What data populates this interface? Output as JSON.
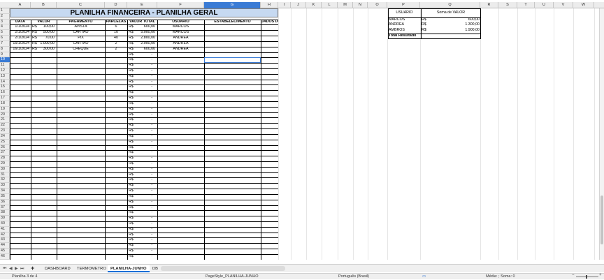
{
  "columns": [
    "A",
    "B",
    "C",
    "D",
    "E",
    "F",
    "G",
    "H",
    "I",
    "J",
    "K",
    "L",
    "M",
    "N",
    "O",
    "P",
    "Q",
    "R",
    "S",
    "T",
    "U",
    "V",
    "W"
  ],
  "selected_column": "G",
  "selected_row": 10,
  "sheet_title": "PLANILHA FINANCEIRA - PLANILHA GERAL",
  "table_headers": [
    "DATA",
    "VALOR",
    "PAGAMENTO",
    "PARCELAS",
    "VALOR TOTAL",
    "USUÁRIO",
    "ESTABELECIMENTO",
    "DADOS DO GASTO"
  ],
  "rows": [
    {
      "data": "1/1/2024",
      "cur": "R$",
      "valor": "100,00",
      "pagamento": "AVISTA",
      "parcelas": "6",
      "cur2": "R$",
      "total": "600,00",
      "usuario": "MARCOS"
    },
    {
      "data": "2/1/2024",
      "cur": "R$",
      "valor": "500,00",
      "pagamento": "CARTÃO",
      "parcelas": "10",
      "cur2": "R$",
      "total": "5.000,00",
      "usuario": "MARCOS"
    },
    {
      "data": "2/1/2024",
      "cur": "R$",
      "valor": "70,00",
      "pagamento": "PIX",
      "parcelas": "40",
      "cur2": "R$",
      "total": "2.800,00",
      "usuario": "ANDREA"
    },
    {
      "data": "15/1/2024",
      "cur": "R$",
      "valor": "1.000,00",
      "pagamento": "CARTÃO",
      "parcelas": "2",
      "cur2": "R$",
      "total": "2.000,00",
      "usuario": "ANDREA"
    },
    {
      "data": "16/1/2024",
      "cur": "R$",
      "valor": "300,00",
      "pagamento": "CHEQUE",
      "parcelas": "2",
      "cur2": "R$",
      "total": "600,00",
      "usuario": "ANDREA"
    }
  ],
  "empty_total_cur": "R$",
  "empty_total_val": "-",
  "pivot": {
    "header_label": "USUÁRIO",
    "header_value": "Soma de VALOR",
    "rows": [
      {
        "label": "MARCOS",
        "cur": "R$",
        "value": "600,00"
      },
      {
        "label": "ANDREA",
        "cur": "R$",
        "value": "1.300,00"
      },
      {
        "label": "AMBROS",
        "cur": "R$",
        "value": "1.900,00"
      }
    ],
    "total_label": "Total Resultado"
  },
  "tabs": [
    "DASHBOARD",
    "TERMOMETRO",
    "PLANILHA-JUNHO",
    "DB"
  ],
  "active_tab": "PLANILHA-JUNHO",
  "add_sheet": "+",
  "status": {
    "sheet_pos": "Planilha 3 de 4",
    "page_style": "PageStyle_PLANILHA-JUNHO",
    "language": "Português (Brasil)",
    "summary": "Média: ; Soma: 0"
  }
}
